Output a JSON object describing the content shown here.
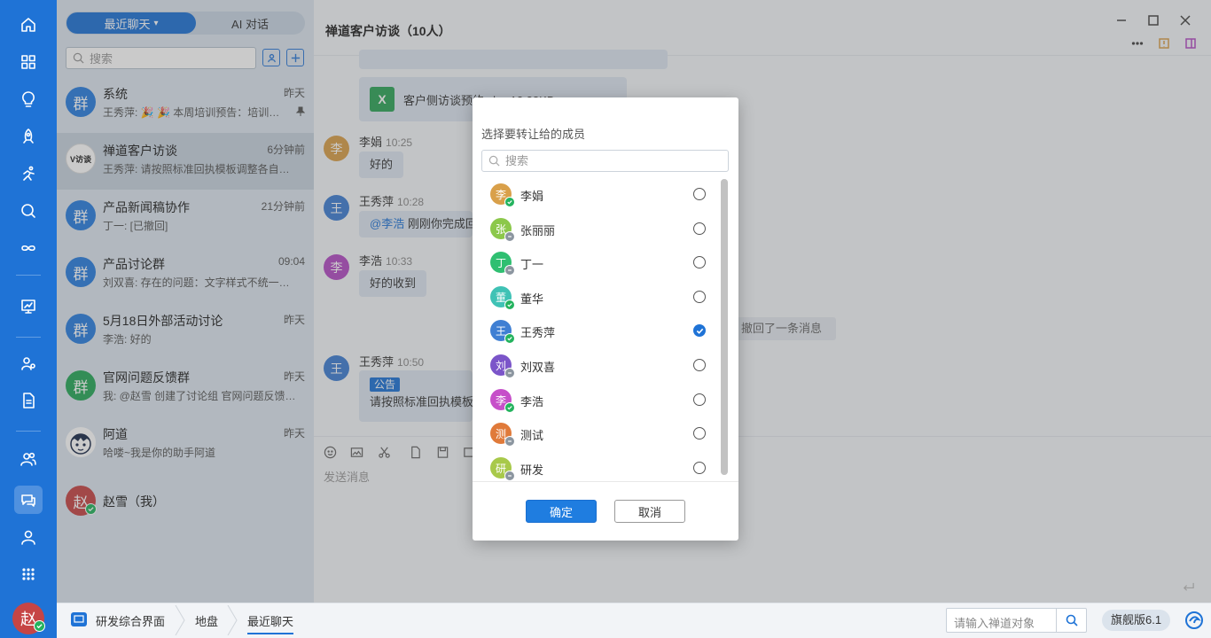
{
  "sidebar_tabs": {
    "recent": "最近聊天",
    "ai": "AI 对话"
  },
  "list_search_placeholder": "搜索",
  "conversations": [
    {
      "avatar": "群",
      "title": "系统",
      "time": "昨天",
      "preview": "王秀萍: 🎉 🎉 本周培训预告：培训主题…",
      "color": "#2a7fe0"
    },
    {
      "avatar": "V访谈",
      "title": "禅道客户访谈",
      "time": "6分钟前",
      "preview": "王秀萍: 请按照标准回执模板调整各自的…",
      "color": "#ffffff"
    },
    {
      "avatar": "群",
      "title": "产品新闻稿协作",
      "time": "21分钟前",
      "preview": "丁一: [已撤回]",
      "color": "#2a7fe0"
    },
    {
      "avatar": "群",
      "title": "产品讨论群",
      "time": "09:04",
      "preview": "刘双喜: 存在的问题：文字样式不统一；…",
      "color": "#2a7fe0"
    },
    {
      "avatar": "群",
      "title": "5月18日外部活动讨论",
      "time": "昨天",
      "preview": "李浩: 好的",
      "color": "#2a7fe0"
    },
    {
      "avatar": "群",
      "title": "官网问题反馈群",
      "time": "昨天",
      "preview": "我: @赵雪 创建了讨论组 官网问题反馈…",
      "color": "#27a85a"
    },
    {
      "avatar": "",
      "title": "阿道",
      "time": "昨天",
      "preview": "哈喽~我是你的助手阿道",
      "color": "#ffffff"
    },
    {
      "avatar": "赵",
      "title": "赵雪（我）",
      "time": "",
      "preview": "",
      "color": "#c64545"
    }
  ],
  "chat": {
    "title": "禅道客户访谈（10人）",
    "file_name": "客户侧访谈预约.xlsx  12.28KB",
    "file_icon": "X",
    "messages": [
      {
        "avatar": "李",
        "name": "李娟",
        "time": "10:25",
        "text": "好的",
        "color": "#d9a04a"
      },
      {
        "avatar": "王",
        "name": "王秀萍",
        "time": "10:28",
        "mention": "@李浩",
        "text": " 刚刚你完成回执了吗",
        "color": "#3f7fd3"
      },
      {
        "avatar": "李",
        "name": "李浩",
        "time": "10:33",
        "text": "好的收到",
        "color": "#b44cc4"
      },
      {
        "avatar": "王",
        "name": "王秀萍",
        "time": "10:50",
        "tag": "公告",
        "text": "请按照标准回执模板调整各自的",
        "color": "#3f7fd3"
      }
    ],
    "recall_notice": "撤回了一条消息",
    "input_placeholder": "发送消息"
  },
  "bottom": {
    "crumbs": [
      "研发综合界面",
      "地盘",
      "最近聊天"
    ],
    "search_placeholder": "请输入禅道对象",
    "version": "旗舰版6.1"
  },
  "modal": {
    "title": "选择要转让给的成员",
    "search_placeholder": "搜索",
    "members": [
      {
        "avatar": "李",
        "name": "李娟",
        "status": "online",
        "color": "#d9a04a",
        "selected": false
      },
      {
        "avatar": "张",
        "name": "张丽丽",
        "status": "away",
        "color": "#8cc84b",
        "selected": false
      },
      {
        "avatar": "丁",
        "name": "丁一",
        "status": "away",
        "color": "#2fbf71",
        "selected": false
      },
      {
        "avatar": "董",
        "name": "董华",
        "status": "online",
        "color": "#3fc2b5",
        "selected": false
      },
      {
        "avatar": "王",
        "name": "王秀萍",
        "status": "online",
        "color": "#3f7fd3",
        "selected": true
      },
      {
        "avatar": "刘",
        "name": "刘双喜",
        "status": "away",
        "color": "#7b55c9",
        "selected": false
      },
      {
        "avatar": "李",
        "name": "李浩",
        "status": "online",
        "color": "#c64fc9",
        "selected": false
      },
      {
        "avatar": "测",
        "name": "测试",
        "status": "away",
        "color": "#e07a3a",
        "selected": false
      },
      {
        "avatar": "研",
        "name": "研发",
        "status": "away",
        "color": "#a8c94a",
        "selected": false
      }
    ],
    "ok_label": "确定",
    "cancel_label": "取消"
  },
  "self_avatar": "赵",
  "colors": {
    "nav": "#1f73d6",
    "accent": "#1f73d6",
    "online": "#24b35e",
    "away": "#8c96a0"
  }
}
